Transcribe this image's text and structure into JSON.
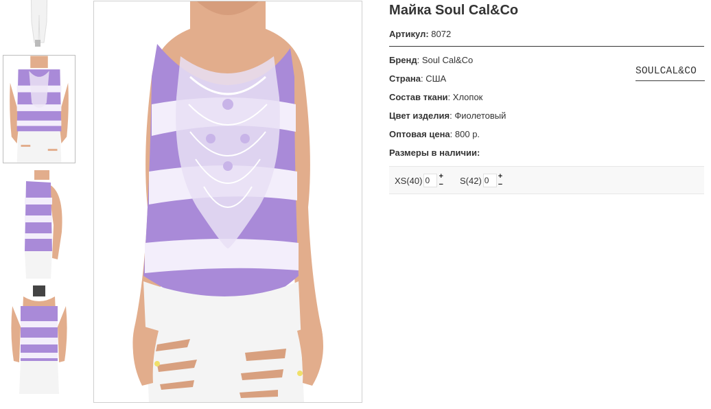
{
  "product": {
    "title": "Майка Soul Cal&Co",
    "sku_label": "Артикул:",
    "sku_value": "8072"
  },
  "attributes": [
    {
      "label": "Бренд",
      "value": "Soul Cal&Co"
    },
    {
      "label": "Страна",
      "value": "США"
    },
    {
      "label": "Состав ткани",
      "value": "Хлопок"
    },
    {
      "label": "Цвет изделия",
      "value": "Фиолетовый"
    },
    {
      "label": "Оптовая цена",
      "value": "800 р."
    }
  ],
  "sizes_heading": "Размеры в наличии:",
  "sizes": [
    {
      "label": "XS(40)",
      "qty": "0",
      "plus": "+",
      "minus": "−"
    },
    {
      "label": "S(42)",
      "qty": "0",
      "plus": "+",
      "minus": "−"
    }
  ],
  "brand_logo_text": "SOULCAL&CO",
  "colors": {
    "purple": "#a98ad8",
    "white_band": "#f3eefb",
    "skin": "#e2ad8c",
    "jeans": "#f4f4f4"
  }
}
